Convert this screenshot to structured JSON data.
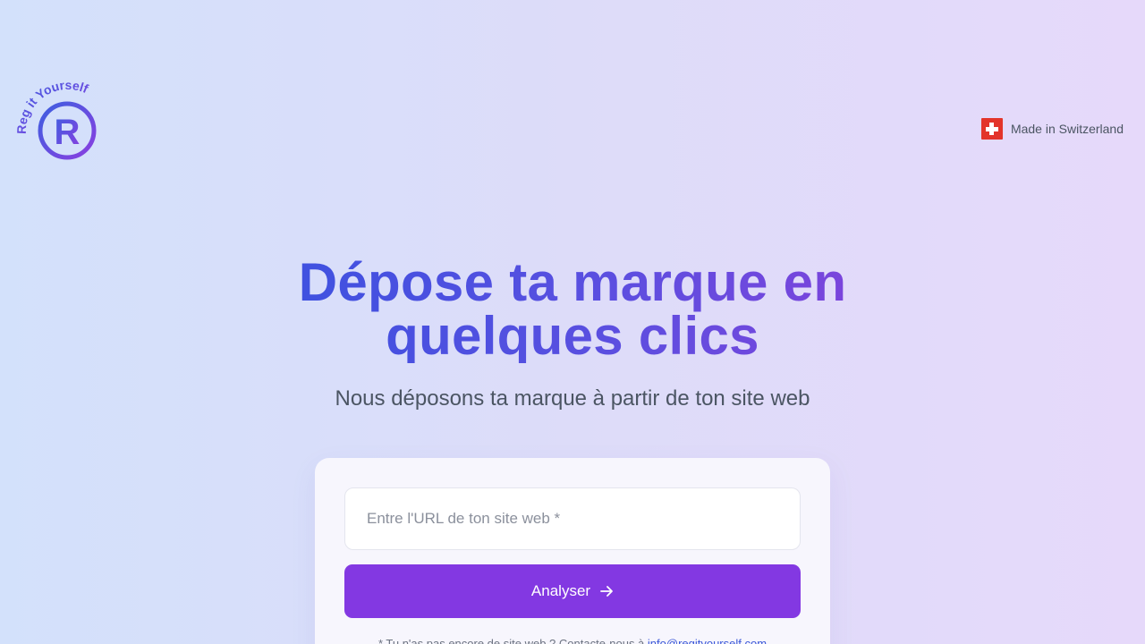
{
  "logo": {
    "arc_text": "Reg it Yourself",
    "letter": "R"
  },
  "badge": {
    "icon": "swiss-flag-icon",
    "text": "Made in Switzerland"
  },
  "hero": {
    "title_line1": "Dépose ta marque en",
    "title_line2": "quelques clics",
    "subtitle": "Nous déposons ta marque à partir de ton site web"
  },
  "form": {
    "url_placeholder": "Entre l'URL de ton site web *",
    "url_value": "",
    "submit_label": "Analyser",
    "submit_icon": "arrow-right-icon"
  },
  "note": {
    "text": "* Tu n'as pas encore de site web ? Contacte-nous à ",
    "email": "info@regityourself.com"
  },
  "colors": {
    "primary": "#8338e2",
    "title_start": "#3f51e0",
    "title_end": "#7a45dc",
    "swiss_red": "#e3342a"
  }
}
